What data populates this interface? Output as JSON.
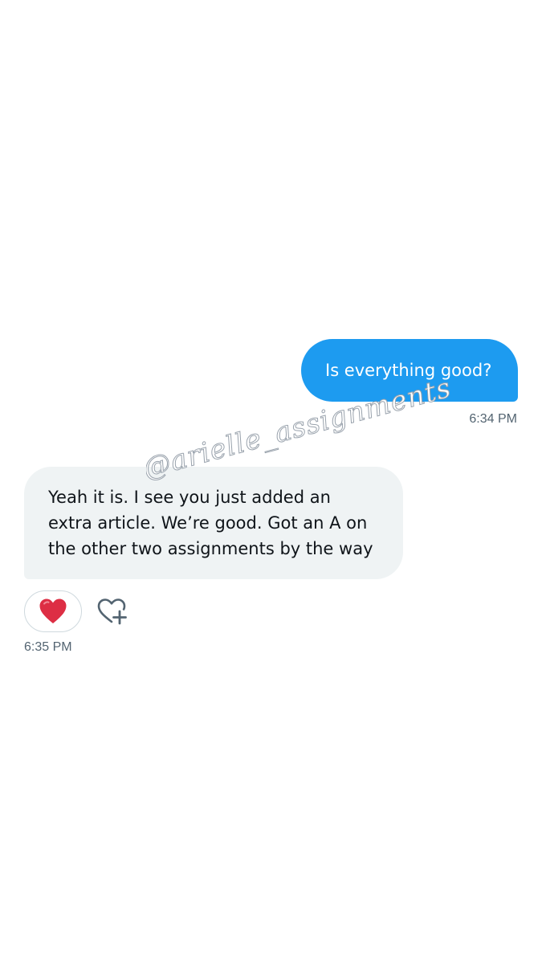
{
  "messages": {
    "outgoing": {
      "text": "Is everything good?",
      "time": "6:34 PM",
      "color": "#1d9bf0"
    },
    "incoming": {
      "text": "Yeah it is. I see you just added an extra article. We’re good. Got an A on the other two assignments by the way",
      "time": "6:35 PM",
      "reaction": "heart-emoji",
      "color": "#eff3f4"
    }
  },
  "icons": {
    "reaction_emoji": "heart-icon",
    "add_reaction": "heart-plus-icon"
  },
  "watermark": {
    "text": "@arielle_assignments"
  }
}
